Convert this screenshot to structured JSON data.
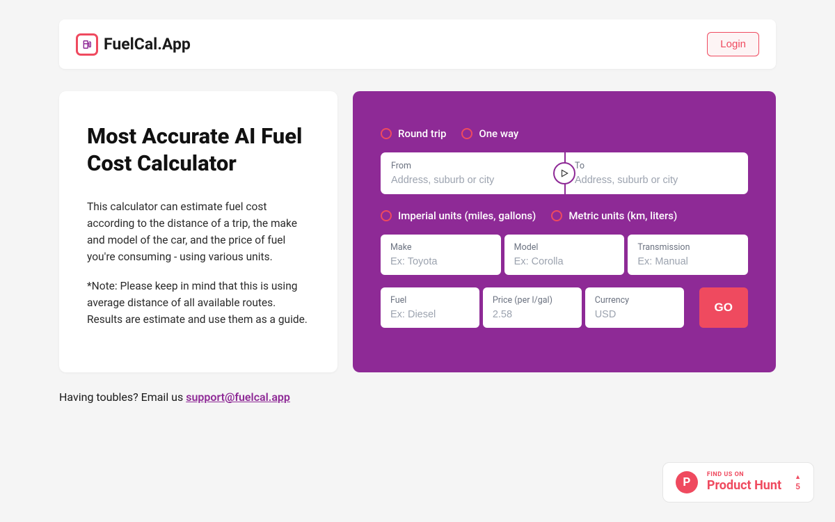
{
  "header": {
    "app_name": "FuelCal.App",
    "login_label": "Login"
  },
  "intro": {
    "title": "Most Accurate AI Fuel Cost Calculator",
    "p1": "This calculator can estimate fuel cost according to the distance of a trip, the make and model of the car, and the price of fuel you're consuming - using various units.",
    "p2": "*Note: Please keep in mind that this is using average distance of all available routes. Results are estimate and use them as a guide."
  },
  "form": {
    "trip_type": {
      "round": "Round trip",
      "oneway": "One way"
    },
    "from_label": "From",
    "from_placeholder": "Address, suburb or city",
    "to_label": "To",
    "to_placeholder": "Address, suburb or city",
    "units": {
      "imperial": "Imperial units (miles, gallons)",
      "metric": "Metric units (km, liters)"
    },
    "make_label": "Make",
    "make_placeholder": "Ex: Toyota",
    "model_label": "Model",
    "model_placeholder": "Ex: Corolla",
    "trans_label": "Transmission",
    "trans_placeholder": "Ex: Manual",
    "fuel_label": "Fuel",
    "fuel_placeholder": "Ex: Diesel",
    "price_label": "Price (per l/gal)",
    "price_placeholder": "2.58",
    "currency_label": "Currency",
    "currency_placeholder": "USD",
    "go_label": "GO"
  },
  "support": {
    "prefix": "Having toubles? Email us ",
    "email": "support@fuelcal.app"
  },
  "ph": {
    "find": "FIND US ON",
    "name": "Product Hunt",
    "count": "5"
  }
}
